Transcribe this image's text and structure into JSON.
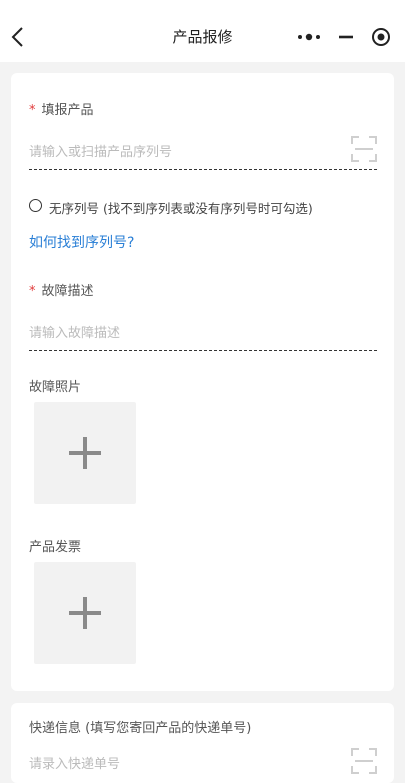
{
  "nav": {
    "title": "产品报修",
    "back_icon": "chevron-left-icon",
    "more_icon": "more-dots-icon",
    "minimize_icon": "minimize-icon",
    "close_icon": "close-target-icon"
  },
  "form": {
    "product": {
      "label": "填报产品",
      "required_mark": "*",
      "placeholder": "请输入或扫描产品序列号"
    },
    "no_serial": {
      "label": "无序列号 (找不到序列表或没有序列号时可勾选)",
      "checked": false
    },
    "find_serial_link": "如何找到序列号?",
    "fault_desc": {
      "label": "故障描述",
      "required_mark": "*",
      "placeholder": "请输入故障描述"
    },
    "fault_photo": {
      "label": "故障照片"
    },
    "invoice": {
      "label": "产品发票"
    },
    "express": {
      "label": "快递信息 (填写您寄回产品的快递单号)",
      "placeholder": "请录入快递单号"
    }
  },
  "colors": {
    "accent_link": "#2a7fd6",
    "required": "#e03a3a",
    "background": "#f3f3f3"
  }
}
